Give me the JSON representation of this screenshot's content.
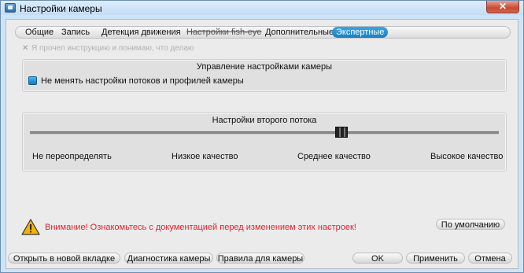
{
  "window": {
    "title": "Настройки камеры",
    "close_glyph": "✕"
  },
  "tabs": [
    {
      "label": "Общие"
    },
    {
      "label": "Запись"
    },
    {
      "label": "Детекция движения"
    },
    {
      "label": "Настройки fish-eye"
    },
    {
      "label": "Дополнительные"
    },
    {
      "label": "Экспертные",
      "active": true
    }
  ],
  "acknowledge": {
    "label": "Я прочел инструкцию и понимаю, что делаю",
    "checked": true,
    "enabled": false,
    "mark": "✕"
  },
  "camera_settings_group": {
    "title": "Управление настройками камеры",
    "keep_streams_checkbox": {
      "label": "Не менять настройки потоков и профилей камеры",
      "checked": true
    }
  },
  "second_stream_group": {
    "title": "Настройки второго потока",
    "slider": {
      "labels": [
        "Не переопределять",
        "Низкое качество",
        "Среднее качество",
        "Высокое качество"
      ],
      "selected_index": 2
    }
  },
  "warning": {
    "text": "Внимание! Ознакомьтесь с документацией перед изменением этих настроек!",
    "icon": "warning-triangle-icon"
  },
  "buttons": {
    "defaults": "По умолчанию",
    "open_new_tab": "Открыть в новой вкладке",
    "camera_diagnostics": "Диагностика камеры",
    "camera_rules": "Правила для камеры",
    "ok": "OK",
    "apply": "Применить",
    "cancel": "Отмена"
  },
  "colors": {
    "accent": "#1a85cc",
    "warning": "#e0222e",
    "window_frame": "#cde4f8"
  }
}
